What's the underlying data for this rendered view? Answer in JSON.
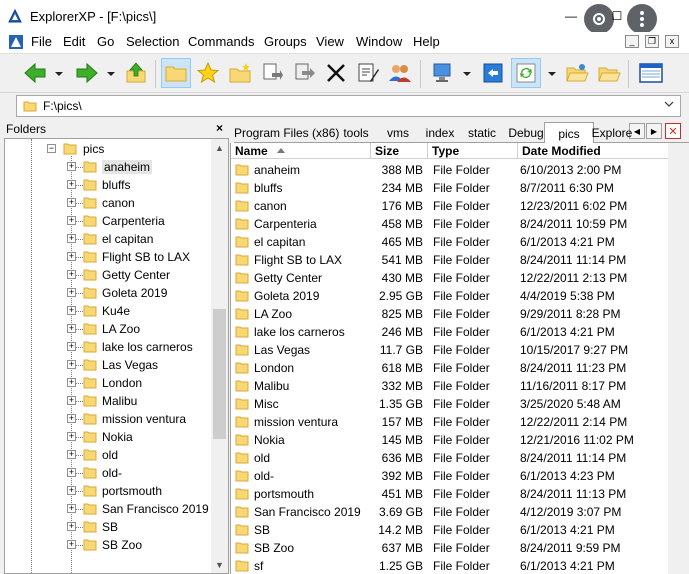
{
  "window": {
    "title": "ExplorerXP - [F:\\pics\\]",
    "minimize_label": "—",
    "maximize_label": "☐",
    "close_label": "✕"
  },
  "menu": {
    "items": [
      "File",
      "Edit",
      "Go",
      "Selection",
      "Commands",
      "Groups",
      "View",
      "Window",
      "Help"
    ],
    "mdi_minimize": "_",
    "mdi_restore": "❐",
    "mdi_close": "x"
  },
  "toolbar": {
    "buttons": [
      "back-arrow-icon",
      "forward-arrow-icon",
      "up-folder-icon",
      "folder-tree-icon",
      "favorites-star-icon",
      "new-folder-icon",
      "copy-to-icon",
      "move-to-icon",
      "delete-icon",
      "rename-icon",
      "users-icon",
      "computer-icon",
      "command-prompt-icon",
      "refresh-icon",
      "open-folder-icon",
      "folder-icon",
      "windows-icon"
    ]
  },
  "address": {
    "path": "F:\\pics\\"
  },
  "folders_panel": {
    "title": "Folders",
    "close_label": "×",
    "root": "pics",
    "items": [
      "anaheim",
      "bluffs",
      "canon",
      "Carpenteria",
      "el capitan",
      "Flight SB to LAX",
      "Getty Center",
      "Goleta 2019",
      "Ku4e",
      "LA Zoo",
      "lake los carneros",
      "Las Vegas",
      "London",
      "Malibu",
      "mission ventura",
      "Nokia",
      "old",
      "old-",
      "portsmouth",
      "San Francisco 2019",
      "SB",
      "SB Zoo"
    ]
  },
  "tabs": {
    "items": [
      "Program Files (x86)",
      "tools",
      "vms",
      "index",
      "static",
      "Debug",
      "pics",
      "Explore"
    ],
    "active": "pics",
    "prev_label": "◀",
    "next_label": "▶",
    "close_label": "✕"
  },
  "file_list": {
    "columns": [
      "Name",
      "Size",
      "Type",
      "Date Modified"
    ],
    "rows": [
      {
        "name": "anaheim",
        "size": "388 MB",
        "type": "File Folder",
        "date": "6/10/2013 2:00 PM"
      },
      {
        "name": "bluffs",
        "size": "234 MB",
        "type": "File Folder",
        "date": "8/7/2011 6:30 PM"
      },
      {
        "name": "canon",
        "size": "176 MB",
        "type": "File Folder",
        "date": "12/23/2011 6:02 PM"
      },
      {
        "name": "Carpenteria",
        "size": "458 MB",
        "type": "File Folder",
        "date": "8/24/2011 10:59 PM"
      },
      {
        "name": "el capitan",
        "size": "465 MB",
        "type": "File Folder",
        "date": "6/1/2013 4:21 PM"
      },
      {
        "name": "Flight SB to LAX",
        "size": "541 MB",
        "type": "File Folder",
        "date": "8/24/2011 11:14 PM"
      },
      {
        "name": "Getty Center",
        "size": "430 MB",
        "type": "File Folder",
        "date": "12/22/2011 2:13 PM"
      },
      {
        "name": "Goleta 2019",
        "size": "2.95 GB",
        "type": "File Folder",
        "date": "4/4/2019 5:38 PM"
      },
      {
        "name": "LA Zoo",
        "size": "825 MB",
        "type": "File Folder",
        "date": "9/29/2011 8:28 PM"
      },
      {
        "name": "lake los carneros",
        "size": "246 MB",
        "type": "File Folder",
        "date": "6/1/2013 4:21 PM"
      },
      {
        "name": "Las Vegas",
        "size": "11.7 GB",
        "type": "File Folder",
        "date": "10/15/2017 9:27 PM"
      },
      {
        "name": "London",
        "size": "618 MB",
        "type": "File Folder",
        "date": "8/24/2011 11:23 PM"
      },
      {
        "name": "Malibu",
        "size": "332 MB",
        "type": "File Folder",
        "date": "11/16/2011 8:17 PM"
      },
      {
        "name": "Misc",
        "size": "1.35 GB",
        "type": "File Folder",
        "date": "3/25/2020 5:48 AM"
      },
      {
        "name": "mission ventura",
        "size": "157 MB",
        "type": "File Folder",
        "date": "12/22/2011 2:14 PM"
      },
      {
        "name": "Nokia",
        "size": "145 MB",
        "type": "File Folder",
        "date": "12/21/2016 11:02 PM"
      },
      {
        "name": "old",
        "size": "636 MB",
        "type": "File Folder",
        "date": "8/24/2011 11:14 PM"
      },
      {
        "name": "old-",
        "size": "392 MB",
        "type": "File Folder",
        "date": "6/1/2013 4:23 PM"
      },
      {
        "name": "portsmouth",
        "size": "451 MB",
        "type": "File Folder",
        "date": "8/24/2011 11:13 PM"
      },
      {
        "name": "San Francisco 2019",
        "size": "3.69 GB",
        "type": "File Folder",
        "date": "4/12/2019 3:07 PM"
      },
      {
        "name": "SB",
        "size": "14.2 MB",
        "type": "File Folder",
        "date": "6/1/2013 4:21 PM"
      },
      {
        "name": "SB Zoo",
        "size": "637 MB",
        "type": "File Folder",
        "date": "8/24/2011 9:59 PM"
      },
      {
        "name": "sf",
        "size": "1.25 GB",
        "type": "File Folder",
        "date": "6/1/2013 4:21 PM"
      }
    ]
  },
  "colors": {
    "folder_yellow": "#f8d775",
    "folder_edge": "#d9a934",
    "accent_blue": "#0078d7"
  }
}
